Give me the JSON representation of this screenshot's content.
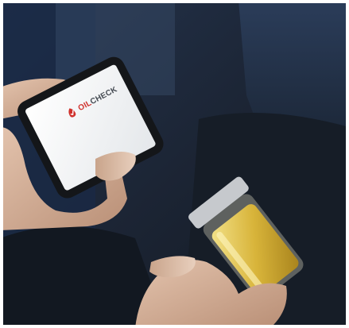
{
  "photo": {
    "subject": "hands-holding-phone-and-oil-sample-bottle"
  },
  "app_logo": {
    "brand_part_1": "OIL",
    "brand_part_2": "CHECK",
    "brand_color": "#d0302b",
    "text_color": "#444a52"
  },
  "colors": {
    "background": "#1b2330",
    "screen": "#f4f5f6",
    "oil": "#d8b43a"
  }
}
